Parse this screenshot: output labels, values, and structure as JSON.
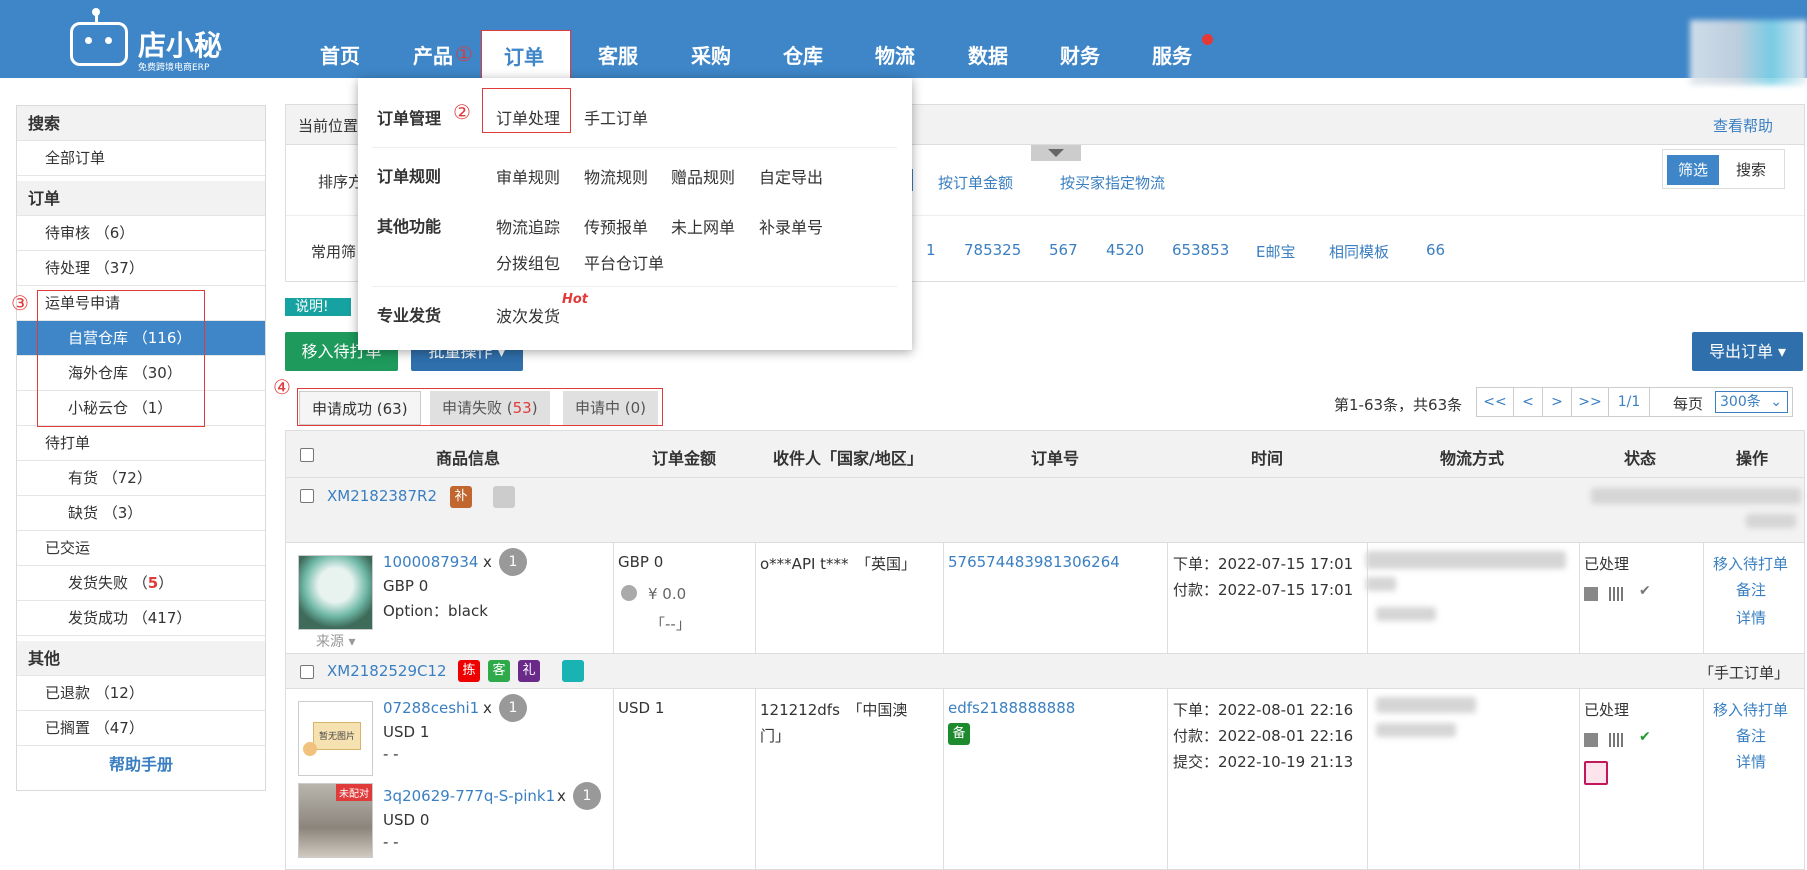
{
  "header": {
    "logo_name": "店小秘",
    "logo_sub": "免费跨境电商ERP",
    "nav": [
      "首页",
      "产品",
      "订单",
      "客服",
      "采购",
      "仓库",
      "物流",
      "数据",
      "财务",
      "服务"
    ],
    "markers": [
      "①",
      "②",
      "③",
      "④"
    ]
  },
  "dropdown": {
    "order_mgmt": "订单管理",
    "order_process": "订单处理",
    "manual_order": "手工订单",
    "order_rules": "订单规则",
    "rules": [
      "审单规则",
      "物流规则",
      "赠品规则",
      "自定导出"
    ],
    "other_func": "其他功能",
    "other1": [
      "物流追踪",
      "传预报单",
      "未上网单",
      "补录单号"
    ],
    "other2": [
      "分拨组包",
      "平台仓订单"
    ],
    "pro_ship": "专业发货",
    "batch_ship": "波次发货",
    "hot": "Hot"
  },
  "sidebar": {
    "search": "搜索",
    "all_orders": "全部订单",
    "orders": "订单",
    "pending_review": "待审核 （6）",
    "pending_process": "待处理 （37）",
    "waybill": "运单号申请",
    "own_wh": "自营仓库 （116）",
    "overseas_wh": "海外仓库 （30）",
    "cloud_wh": "小秘云仓 （1）",
    "to_print": "待打单",
    "in_stock": "有货 （72）",
    "out_stock": "缺货 （3）",
    "shipped": "已交运",
    "ship_fail_label": "发货失败 （",
    "ship_fail_count": "5",
    "ship_fail_end": "）",
    "ship_ok": "发货成功 （417）",
    "others": "其他",
    "refunded": "已退款 （12）",
    "shelved": "已搁置 （47）",
    "help": "帮助手册"
  },
  "panel": {
    "location": "当前位置",
    "help": "查看帮助",
    "sort": "排序方",
    "sort_amount": "按订单金额",
    "sort_buyer": "按买家指定物流",
    "filter_btn": "筛选",
    "search_btn": "搜索",
    "common": "常用筛",
    "filters": [
      "1",
      "785325",
      "567",
      "4520",
      "653853",
      "E邮宝",
      "相同模板",
      "66"
    ],
    "notice": "说明!"
  },
  "toolbar": {
    "move_print": "移入待打单",
    "batch": "批量操作 ▾",
    "export": "导出订单 ▾"
  },
  "tabs": {
    "success": "申请成功 (63)",
    "fail_label": "申请失败 (",
    "fail_count": "53",
    "fail_end": ")",
    "pending": "申请中 (0)"
  },
  "pager": {
    "info": "第1-63条，共63条",
    "buttons": [
      "<<",
      "<",
      ">",
      ">>",
      "1/1"
    ],
    "per_page": "每页",
    "per_page_value": "300条"
  },
  "table": {
    "columns": [
      "商品信息",
      "订单金额",
      "收件人「国家/地区」",
      "订单号",
      "时间",
      "物流方式",
      "状态",
      "操作"
    ]
  },
  "orders": [
    {
      "id": "XM2182387R2",
      "badge": "补",
      "sku": "1000087934",
      "x": "x",
      "qty": "1",
      "price": "GBP 0",
      "option": "Option：black",
      "source": "来源 ▾",
      "amount": "GBP 0",
      "amount2": "¥ 0.0",
      "amount3": "「--」",
      "recipient": "o***API t***　「英国」",
      "order_no": "576574483981306264",
      "time1": "下单：2022-07-15 17:01",
      "time2": "付款：2022-07-15 17:01",
      "status": "已处理",
      "ops": [
        "移入待打单",
        "备注",
        "详情"
      ]
    },
    {
      "id": "XM2182529C12",
      "badges": [
        "拣",
        "客",
        "礼"
      ],
      "tag": "「手工订单」",
      "sku1": "07288ceshi1",
      "qty1": "1",
      "price1": "USD 1",
      "dash1": "- -",
      "img_placeholder": "暂无图片",
      "sku2": "3q20629-777q-S-pink1",
      "qty2": "1",
      "price2": "USD 0",
      "dash2": "- -",
      "unmatched": "未配对",
      "x": "x",
      "amount": "USD 1",
      "recipient1": "121212dfs　「中国澳",
      "recipient2": "门」",
      "order_no": "edfs2188888888",
      "order_badge": "备",
      "time1": "下单：2022-08-01 22:16",
      "time2": "付款：2022-08-01 22:16",
      "time3": "提交：2022-10-19 21:13",
      "status": "已处理",
      "ops": [
        "移入待打单",
        "备注",
        "详情"
      ]
    }
  ],
  "colors": {
    "header": "#3e86c8",
    "accent_red": "#e03b3b",
    "green": "#1e9a5c",
    "link": "#3a7fc1"
  }
}
